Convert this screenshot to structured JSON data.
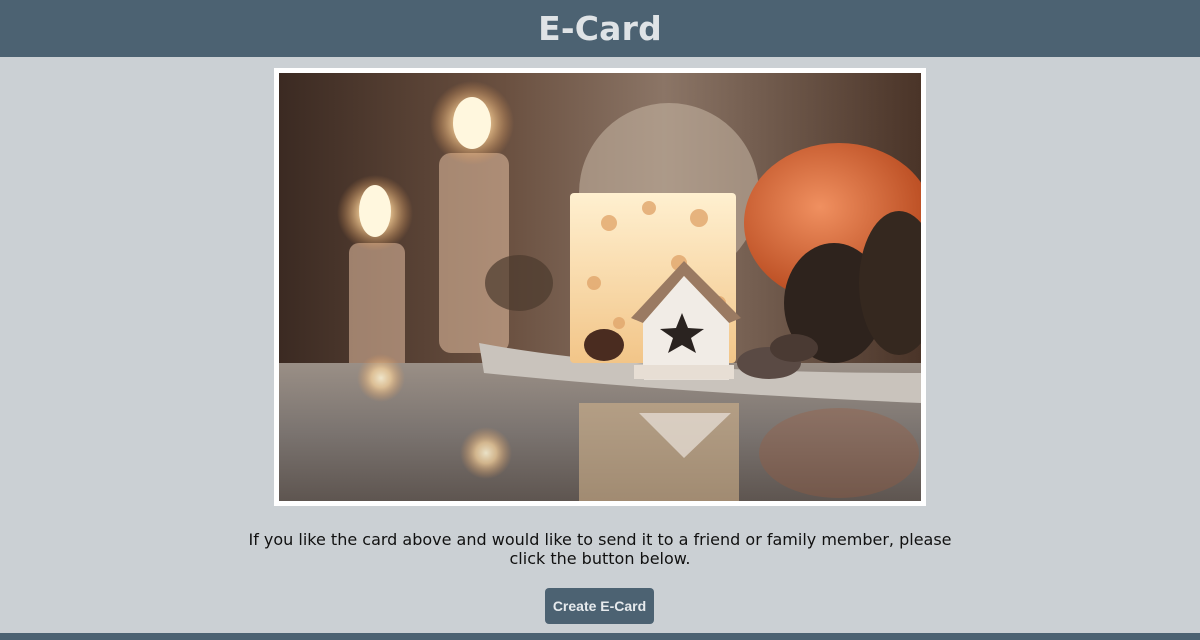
{
  "header": {
    "title": "E-Card"
  },
  "card": {
    "image_alt": "Cozy autumn still life: candles, small wooden house with star, pinecones and pumpkin on a reflective table"
  },
  "message": {
    "text": "If you like the card above and would like to send it to a friend or family member, please click the button below."
  },
  "actions": {
    "create_label": "Create E-Card"
  },
  "colors": {
    "header_bg": "#4c6272",
    "page_bg": "#cbd0d4",
    "button_bg": "#4c6272"
  }
}
